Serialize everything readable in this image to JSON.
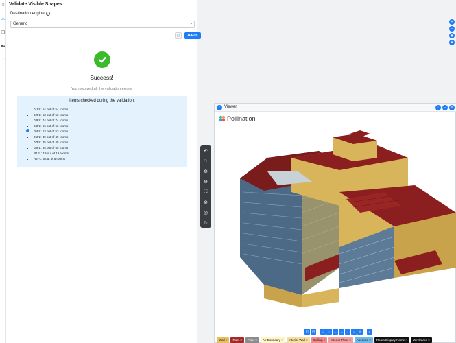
{
  "panel": {
    "title": "Validate Visible Shapes",
    "engine_label": "Destination engine",
    "engine_value": "Generic",
    "run_label": "Run"
  },
  "result": {
    "title": "Success!",
    "message": "You resolved all the validation errors.",
    "items_title": "Items checked during the validation:",
    "items": [
      "01FL: 54 out of 54 rooms",
      "02FL: 53 out of 53 rooms",
      "03FL: 74 out of 74 rooms",
      "04FL: 66 out of 66 rooms",
      "05FL: 53 out of 53 rooms",
      "06FL: 49 out of 49 rooms",
      "07FL: 45 out of 45 rooms",
      "08FL: 55 out of 55 rooms",
      "R1FL: 19 out of 19 rooms",
      "R2FL: 5 out of 5 rooms"
    ]
  },
  "viewer": {
    "title": "Viewer",
    "brand": "Pollination"
  },
  "legend": [
    {
      "label": "Wall",
      "color": "#e8c060"
    },
    {
      "label": "Roof",
      "color": "#a32a2a"
    },
    {
      "label": "Floor",
      "color": "#8c8c8c"
    },
    {
      "label": "Air Boundary",
      "color": "#fff6c8"
    },
    {
      "label": "Interior Wall",
      "color": "#f4dea0"
    },
    {
      "label": "Ceiling",
      "color": "#f28a8a"
    },
    {
      "label": "Interior Floor",
      "color": "#f4a0a0"
    },
    {
      "label": "Aperture",
      "color": "#6fb8e8"
    },
    {
      "label": "Room Display Name",
      "color": "#111111"
    },
    {
      "label": "Wireframe",
      "color": "#111111"
    }
  ],
  "colors": {
    "accent": "#1f7ef5",
    "success": "#3cba2c",
    "info_bg": "#e4f2fd"
  }
}
